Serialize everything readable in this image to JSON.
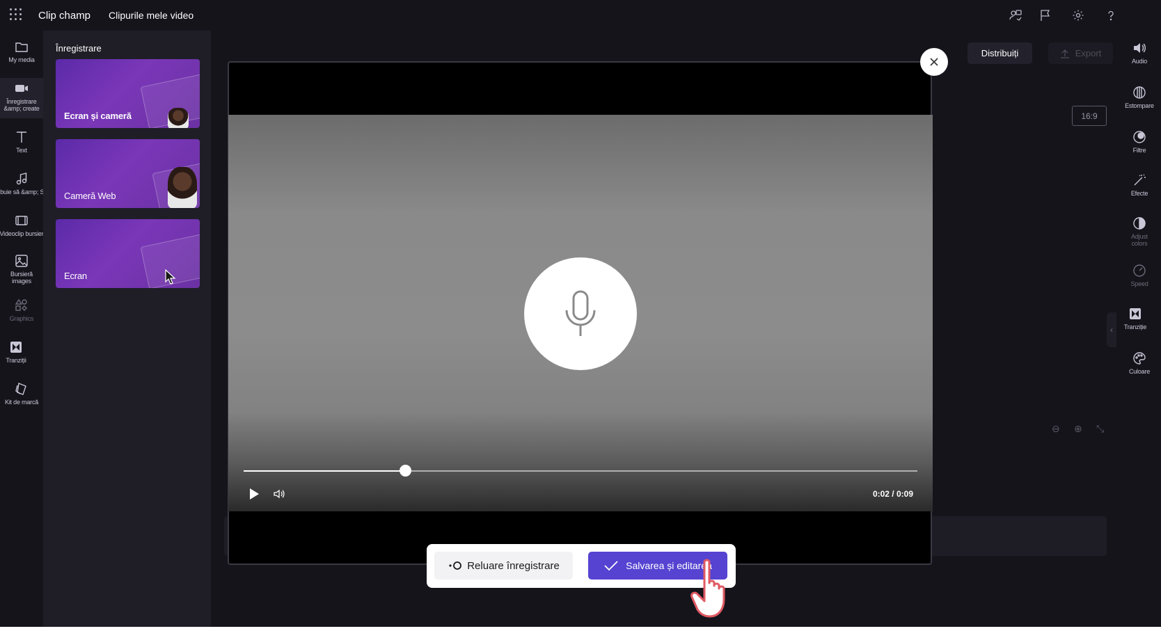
{
  "header": {
    "brand": "Clip champ",
    "nav_videos": "Clipurile mele video"
  },
  "left_rail": {
    "items": [
      {
        "label": "My media",
        "icon": "folder-icon"
      },
      {
        "label": "Înregistrare &amp; create",
        "icon": "video-camera-icon"
      },
      {
        "label": "Text",
        "icon": "text-icon"
      },
      {
        "label": "Trebuie să &amp; SFX",
        "icon": "music-note-icon"
      },
      {
        "label": "Videoclip bursier",
        "icon": "film-icon"
      },
      {
        "label": "Bursieră images",
        "icon": "image-icon"
      },
      {
        "label": "Graphics",
        "icon": "shapes-icon"
      },
      {
        "label": "Tranziții",
        "icon": "transition-icon"
      },
      {
        "label": "Kit de marcă",
        "icon": "brand-kit-icon"
      }
    ]
  },
  "panel": {
    "title": "Înregistrare",
    "cards": [
      {
        "label": "Ecran și cameră"
      },
      {
        "label": "Cameră Web"
      },
      {
        "label": "Ecran"
      }
    ]
  },
  "toolbar": {
    "share_label": "Distribuiți",
    "export_label": "Export",
    "aspect_ratio": "16:9"
  },
  "right_rail": {
    "items": [
      {
        "label": "Audio",
        "icon": "speaker-icon"
      },
      {
        "label": "Estompare",
        "icon": "fade-icon"
      },
      {
        "label": "Filtre",
        "icon": "filter-icon"
      },
      {
        "label": "Efecte",
        "icon": "magic-wand-icon"
      },
      {
        "label": "Adjust colors",
        "icon": "contrast-icon"
      },
      {
        "label": "Speed",
        "icon": "speedometer-icon"
      },
      {
        "label": "Tranziție",
        "icon": "transition-icon"
      },
      {
        "label": "Culoare",
        "icon": "palette-icon"
      }
    ]
  },
  "player": {
    "time": "0:02 / 0:09",
    "progress": 0.24
  },
  "actions": {
    "retake_label": "Reluare înregistrare",
    "save_label": "Salvarea și editarea"
  },
  "colors": {
    "background": "#15141b",
    "panel": "#1f1e27",
    "accent": "#5643d1",
    "card_purple": "#6b31a3"
  }
}
